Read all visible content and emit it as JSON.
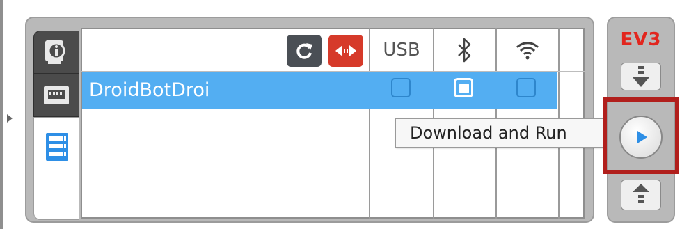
{
  "brick_panel": {
    "tabs": [
      {
        "icon": "brick-info-icon"
      },
      {
        "icon": "port-view-icon"
      },
      {
        "icon": "available-bricks-icon",
        "active": true
      }
    ],
    "header_buttons": [
      {
        "icon": "refresh-icon",
        "color": "#4a4f55"
      },
      {
        "icon": "disconnect-icon",
        "color": "#d63a2a"
      }
    ],
    "columns": {
      "usb": "USB",
      "bluetooth_icon": "bluetooth-icon",
      "wifi_icon": "wifi-icon"
    },
    "rows": [
      {
        "name": "DroidBotDroi",
        "usb": false,
        "bluetooth": true,
        "wifi": false,
        "selected": true
      }
    ]
  },
  "tooltip": {
    "text": "Download and Run"
  },
  "controls": {
    "brand": "EV3",
    "brand_color": "#e2261e",
    "buttons": [
      {
        "icon": "download-icon"
      },
      {
        "icon": "download-and-run-icon",
        "highlighted": true
      },
      {
        "icon": "run-selected-icon"
      }
    ],
    "highlight_color": "#b11f1c",
    "accent_color": "#53aef2"
  }
}
